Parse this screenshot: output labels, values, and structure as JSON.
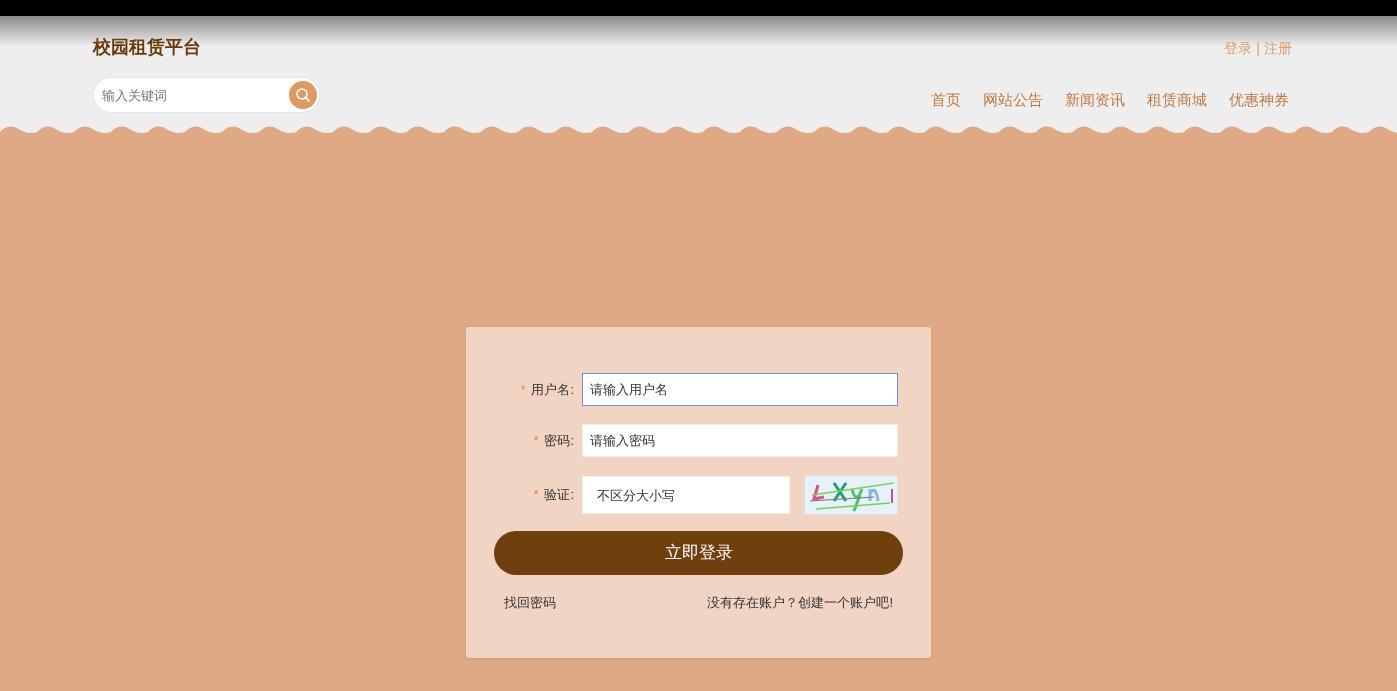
{
  "header": {
    "site_title": "校园租赁平台",
    "auth_links": [
      "登录",
      "注册"
    ],
    "auth_separator": "|",
    "search": {
      "placeholder": "输入关键词"
    },
    "nav": [
      {
        "label": "首页"
      },
      {
        "label": "网站公告"
      },
      {
        "label": "新闻资讯"
      },
      {
        "label": "租赁商城"
      },
      {
        "label": "优惠神券"
      }
    ]
  },
  "login_form": {
    "fields": [
      {
        "kind": "text",
        "label": "用户名:",
        "required_mark": "*",
        "placeholder": "请输入用户名",
        "focused": true
      },
      {
        "kind": "password",
        "label": "密码:",
        "required_mark": "*",
        "placeholder": "请输入密码",
        "focused": false
      },
      {
        "kind": "captcha",
        "label": "验证:",
        "required_mark": "*",
        "placeholder": "不区分大小写",
        "focused": false
      }
    ],
    "submit": "立即登录",
    "forgot_link": "找回密码",
    "register_link": "没有存在账户？创建一个账户吧!"
  }
}
